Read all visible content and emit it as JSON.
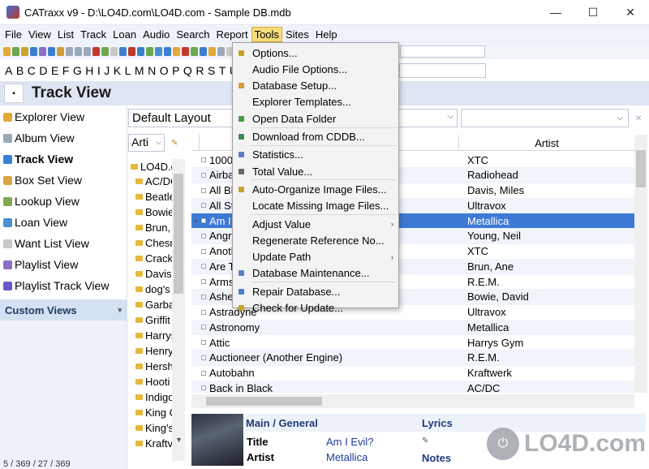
{
  "window": {
    "title": "CATraxx v9 - D:\\LO4D.com\\LO4D.com - Sample DB.mdb",
    "minimize": "—",
    "maximize": "☐",
    "close": "✕"
  },
  "menu": [
    "File",
    "View",
    "List",
    "Track",
    "Loan",
    "Audio",
    "Search",
    "Report",
    "Tools",
    "Sites",
    "Help"
  ],
  "active_menu": "Tools",
  "alphabet": [
    "A",
    "B",
    "C",
    "D",
    "E",
    "F",
    "G",
    "H",
    "I",
    "J",
    "K",
    "L",
    "M",
    "N",
    "O",
    "P",
    "Q",
    "R",
    "S",
    "T",
    "U"
  ],
  "view": {
    "title": "Track View",
    "dropdown_glyph": "▪"
  },
  "sidebar": {
    "items": [
      {
        "label": "Explorer View",
        "icon": "explorer-icon",
        "color": "#e2a83a"
      },
      {
        "label": "Album View",
        "icon": "cd-icon",
        "color": "#9aa8b8"
      },
      {
        "label": "Track View",
        "icon": "track-icon",
        "color": "#3a7fd0"
      },
      {
        "label": "Box Set View",
        "icon": "boxset-icon",
        "color": "#d9a542"
      },
      {
        "label": "Lookup View",
        "icon": "lookup-icon",
        "color": "#7fa850"
      },
      {
        "label": "Loan View",
        "icon": "loan-icon",
        "color": "#4a8fd0"
      },
      {
        "label": "Want List View",
        "icon": "wantlist-icon",
        "color": "#c9c9c9"
      },
      {
        "label": "Playlist View",
        "icon": "playlist-icon",
        "color": "#8a6fc9"
      },
      {
        "label": "Playlist Track View",
        "icon": "playlist-track-icon",
        "color": "#6a5ac9"
      }
    ],
    "custom_views": "Custom Views",
    "custom_views_chevron": "▾"
  },
  "layout": {
    "value": "Default Layout",
    "dropdown_glyph": "⌵"
  },
  "tree": {
    "field": "Arti",
    "dropdown_glyph": "⌵",
    "root": "LO4D.c",
    "nodes": [
      "AC/DC",
      "Beatle",
      "Bowie",
      "Brun, ",
      "Chesn",
      "Crack",
      "Davis,",
      "dog's",
      "Garba",
      "Griffit",
      "Harrys",
      "Henry",
      "Hersh",
      "Hooti",
      "Indigo",
      "King C",
      "King's",
      "Kraftv"
    ]
  },
  "grid": {
    "column_artist": "Artist",
    "rows": [
      {
        "title": "1000 U",
        "artist": "XTC"
      },
      {
        "title": "Airbag",
        "artist": "Radiohead"
      },
      {
        "title": "All Blu",
        "artist": "Davis, Miles"
      },
      {
        "title": "All Sto",
        "artist": "Ultravox"
      },
      {
        "title": "Am I E",
        "artist": "Metallica",
        "selected": true
      },
      {
        "title": "Angry ",
        "artist": "Young, Neil"
      },
      {
        "title": "Anothe",
        "artist": "XTC"
      },
      {
        "title": "Are Th",
        "artist": "Brun, Ane"
      },
      {
        "title": "Arms o",
        "artist": "R.E.M."
      },
      {
        "title": "Ashes ",
        "artist": "Bowie, David"
      },
      {
        "title": "Astradyne",
        "artist": "Ultravox"
      },
      {
        "title": "Astronomy",
        "artist": "Metallica"
      },
      {
        "title": "Attic",
        "artist": "Harrys Gym"
      },
      {
        "title": "Auctioneer (Another Engine)",
        "artist": "R.E.M."
      },
      {
        "title": "Autobahn",
        "artist": "Kraftwerk"
      },
      {
        "title": "Back in Black",
        "artist": "AC/DC"
      }
    ]
  },
  "tools_menu": [
    {
      "label": "Options...",
      "icon": "options-icon",
      "color": "#c9a22e"
    },
    {
      "label": "Audio File Options...",
      "icon": "",
      "color": ""
    },
    {
      "label": "Database Setup...",
      "icon": "database-setup-icon",
      "color": "#d29a3a"
    },
    {
      "label": "Explorer Templates...",
      "icon": "",
      "color": ""
    },
    {
      "label": "Open Data Folder",
      "icon": "open-folder-icon",
      "color": "#4a9a4a"
    },
    {
      "label": "Download from CDDB...",
      "icon": "cddb-icon",
      "color": "#3a8a5a",
      "sep_before": true
    },
    {
      "label": "Statistics...",
      "icon": "statistics-icon",
      "color": "#5a7fc9",
      "sep_before": true
    },
    {
      "label": "Total Value...",
      "icon": "total-value-icon",
      "color": "#6a6a6a"
    },
    {
      "label": "Auto-Organize Image Files...",
      "icon": "auto-organize-icon",
      "color": "#c9a22e",
      "sep_before": true
    },
    {
      "label": "Locate Missing Image Files...",
      "icon": "",
      "color": ""
    },
    {
      "label": "Adjust Value",
      "icon": "",
      "color": "",
      "submenu": true,
      "sep_before": true
    },
    {
      "label": "Regenerate Reference No...",
      "icon": "",
      "color": ""
    },
    {
      "label": "Update Path",
      "icon": "",
      "color": "",
      "submenu": true
    },
    {
      "label": "Database Maintenance...",
      "icon": "db-maintenance-icon",
      "color": "#5a7fc9"
    },
    {
      "label": "Repair Database...",
      "icon": "repair-db-icon",
      "color": "#4a7fc9",
      "sep_before": true
    },
    {
      "label": "Check for Update...",
      "icon": "check-update-icon",
      "color": "#c9a22e"
    }
  ],
  "submenu_arrow": "›",
  "details": {
    "tab_main": "Main / General",
    "tab_lyrics": "Lyrics",
    "title_label": "Title",
    "title_value": "Am I Evil?",
    "artist_label": "Artist",
    "artist_value": "Metallica",
    "notes_label": "Notes"
  },
  "status": "5 / 369 / 27 / 369",
  "watermark": {
    "glyph": "⏻",
    "text": "LO4D.com"
  }
}
